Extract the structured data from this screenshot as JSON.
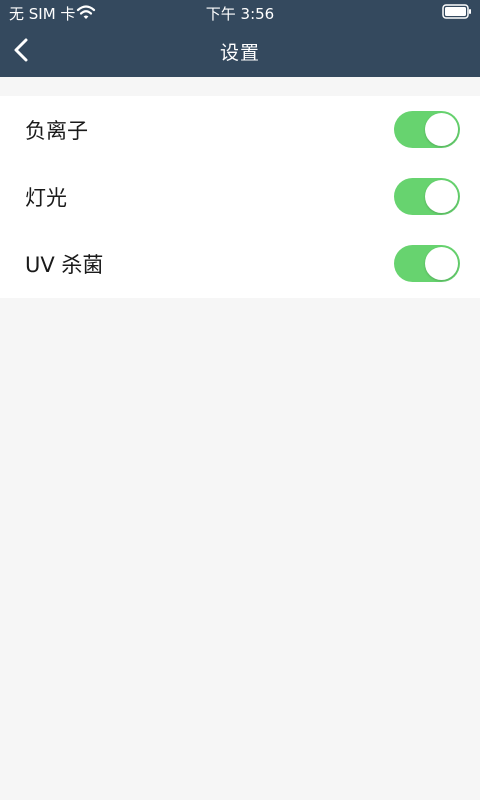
{
  "status_bar": {
    "carrier": "无 SIM 卡",
    "wifi_icon": "wifi-icon",
    "time": "下午 3:56",
    "battery_icon": "battery-icon"
  },
  "nav_bar": {
    "back_icon": "chevron-left-icon",
    "title": "设置"
  },
  "settings": [
    {
      "label": "负离子",
      "enabled": true
    },
    {
      "label": "灯光",
      "enabled": true
    },
    {
      "label": "UV 杀菌",
      "enabled": true
    }
  ],
  "colors": {
    "header_background": "#34495e",
    "toggle_on": "#67d36f",
    "page_background": "#f6f6f6"
  }
}
